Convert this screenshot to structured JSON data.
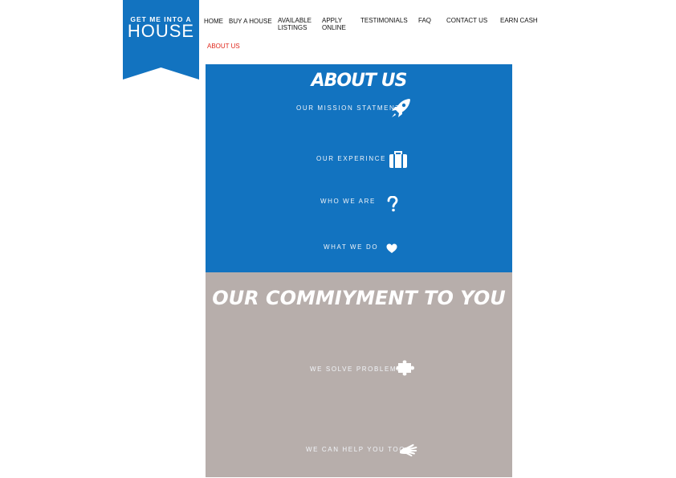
{
  "logo": {
    "line1": "GET ME INTO A",
    "line2": "HOUSE",
    "color": "#1273c0"
  },
  "nav": {
    "home": "HOME",
    "buy": "BUY A HOUSE",
    "listings_1": "AVAILABLE",
    "listings_2": "LISTINGS",
    "apply_1": "APPLY",
    "apply_2": "ONLINE",
    "testimonials": "TESTIMONIALS",
    "faq": "FAQ",
    "contact": "CONTACT US",
    "earn": "EARN CASH",
    "about": "ABOUT US"
  },
  "about": {
    "title": "ABOUT US",
    "color": "#1273c0",
    "items": [
      {
        "label": "OUR MISSION STATMENT",
        "icon": "rocket-icon"
      },
      {
        "label": "OUR EXPERINCE",
        "icon": "briefcase-icon"
      },
      {
        "label": "WHO WE ARE",
        "icon": "question-icon"
      },
      {
        "label": "WHAT WE DO",
        "icon": "heart-icon"
      }
    ]
  },
  "commitment": {
    "title": "OUR COMMIYMENT TO YOU",
    "color": "#b7aeab",
    "items": [
      {
        "label": "WE SOLVE PROBLEMS",
        "icon": "puzzle-icon"
      },
      {
        "label": "WE CAN HELP YOU TOO",
        "icon": "hand-icon"
      }
    ]
  }
}
